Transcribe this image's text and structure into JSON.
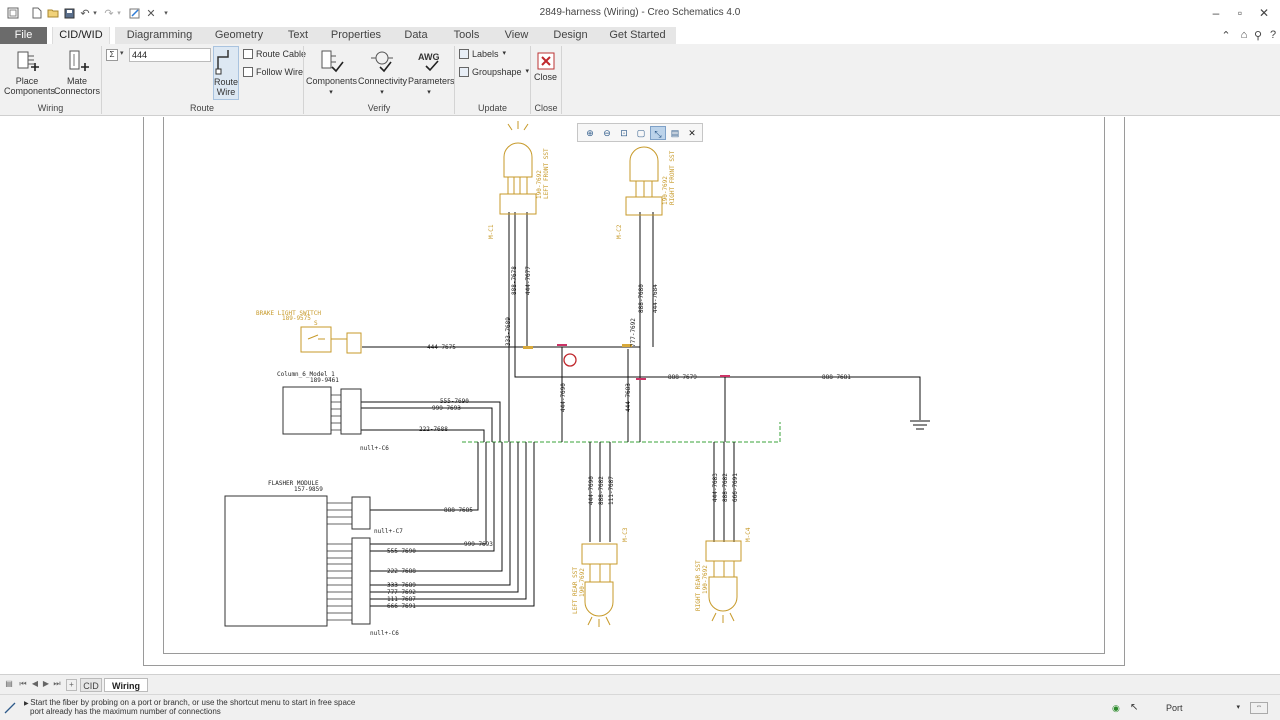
{
  "window": {
    "title": "2849-harness (Wiring) - Creo Schematics 4.0"
  },
  "menu": {
    "tabs": [
      "File",
      "CID/WID",
      "Diagramming",
      "Geometry",
      "Text",
      "Properties",
      "Data",
      "Tools",
      "View",
      "Design",
      "Get Started"
    ],
    "active": "CID/WID"
  },
  "ribbon": {
    "place_components": "Place\nComponents",
    "place_label_1": "Place",
    "place_label_2": "Components",
    "mate_label_1": "Mate",
    "mate_label_2": "Connectors",
    "wire_value": "444",
    "route_cable": "Route Cable",
    "follow_wire": "Follow Wire",
    "route_wire_1": "Route",
    "route_wire_2": "Wire",
    "components": "Components",
    "connectivity": "Connectivity",
    "parameters": "Parameters",
    "awg": "AWG",
    "labels": "Labels",
    "groupshape": "Groupshape",
    "close": "Close",
    "groups": {
      "wiring": "Wiring",
      "route": "Route",
      "verify": "Verify",
      "update": "Update",
      "close": "Close"
    }
  },
  "schematic": {
    "components": {
      "brake_switch_name": "BRAKE LIGHT SWITCH",
      "brake_switch_pn": "189-9575",
      "brake_switch_ref": "S",
      "column_name": "Column_6_Model_1",
      "column_pn": "189-9461",
      "flasher_name": "FLASHER MODULE",
      "flasher_pn": "157-9859",
      "left_front_1": "LEFT FRONT SST",
      "left_front_2": "190-7692",
      "right_front_1": "RIGHT FRONT SST",
      "right_front_2": "190-7692",
      "left_rear_1": "LEFT REAR SST",
      "left_rear_2": "190-7692",
      "right_rear_1": "RIGHT REAR SST",
      "right_rear_2": "190-7692",
      "null_c6": "null+-C6",
      "null_c7": "null+-C7",
      "null_c6b": "null+-C6",
      "lf_conn": "M-C1",
      "rf_conn": "M-C2",
      "lr_conn": "M-C3",
      "rr_conn": "M-C4"
    },
    "wires": {
      "w1": "444-7675",
      "w2": "888-7678",
      "w3": "444-7677",
      "w4": "888-7680",
      "w5": "444-7684",
      "w6": "333-7689",
      "w7": "777-7692",
      "w8": "888-7679",
      "w9": "888-7681",
      "w10": "444-7690",
      "w11": "444-7683",
      "w12": "555-7690",
      "w13": "999-7693",
      "w14": "222-7688",
      "w15": "888-7685",
      "w16": "999-7693",
      "w17": "555-7690",
      "w18": "222-7688",
      "w19": "333-7689",
      "w20": "777-7692",
      "w21": "111-7687",
      "w22": "666-7691",
      "w23": "444-7690",
      "w24": "888-7682",
      "w25": "111-7687",
      "w26": "444-7683",
      "w27": "888-7682",
      "w28": "666-7691"
    }
  },
  "sheet_tabs": {
    "cid": "CID",
    "wiring": "Wiring"
  },
  "status": {
    "line1": "Start the fiber by probing on a port or branch, or use the shortcut menu to start in free space",
    "line2": "port already has the maximum number of connections",
    "filter": "Port"
  },
  "colors": {
    "component": "#c79a2a",
    "wire": "#111111",
    "branch": "#3aa33a",
    "highlight": "#cc3366"
  }
}
